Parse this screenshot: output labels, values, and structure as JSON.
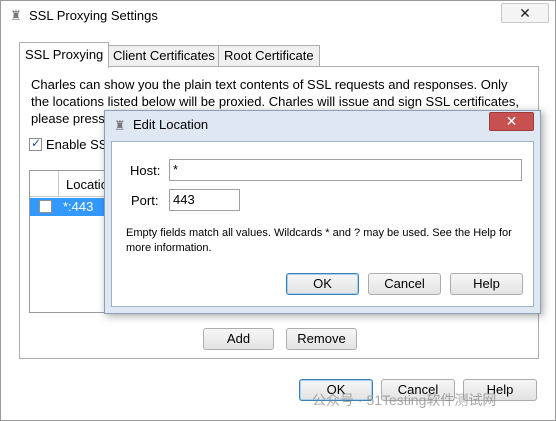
{
  "window": {
    "title": "SSL Proxying Settings",
    "close_glyph": "✕"
  },
  "tabs": [
    {
      "label": "SSL Proxying",
      "active": true
    },
    {
      "label": "Client Certificates",
      "active": false
    },
    {
      "label": "Root Certificate",
      "active": false
    }
  ],
  "panel": {
    "description_line1": "Charles can show you the plain text contents of SSL requests and responses. Only",
    "description_line2": "the locations listed below will be proxied. Charles will issue and sign SSL certificates,",
    "description_line3": "please press",
    "enable_label": "Enable SSL",
    "enable_checked": true,
    "table": {
      "column_header": "Location",
      "rows": [
        {
          "checked": false,
          "location": "*:443"
        }
      ]
    },
    "add_label": "Add",
    "remove_label": "Remove"
  },
  "footer": {
    "ok_label": "OK",
    "cancel_label": "Cancel",
    "help_label": "Help"
  },
  "dialog": {
    "title": "Edit Location",
    "close_glyph": "✕",
    "host_label": "Host:",
    "host_value": "*",
    "port_label": "Port:",
    "port_value": "443",
    "note_line1": "Empty fields match all values. Wildcards * and ? may be used. See the Help for",
    "note_line2": "more information.",
    "ok_label": "OK",
    "cancel_label": "Cancel",
    "help_label": "Help"
  },
  "watermark": "公众号 · 51Testing软件测试网",
  "colors": {
    "selection": "#3399ff",
    "dialog_frame": "#dfe8f2",
    "dialog_close": "#c75050"
  }
}
